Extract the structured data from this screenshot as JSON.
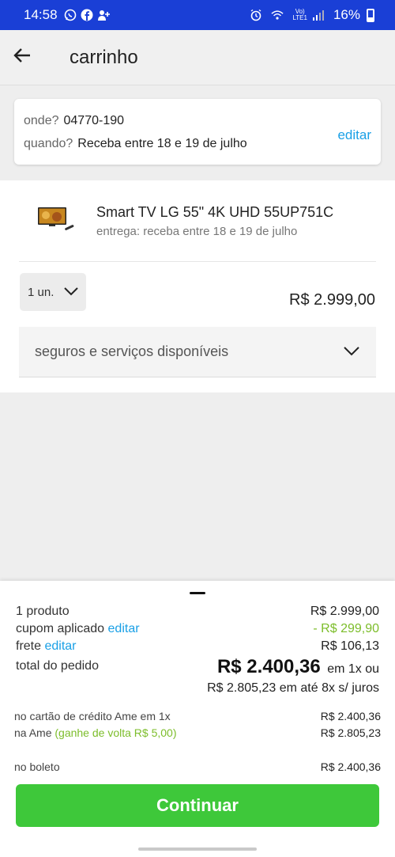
{
  "status_bar": {
    "time": "14:58",
    "network": "Vo)\nLTE1",
    "battery_percent": "16%",
    "left_icons": [
      "whatsapp-icon",
      "facebook-icon",
      "contact-add-icon"
    ],
    "right_icons": [
      "alarm-icon",
      "wifi-icon",
      "signal-icon",
      "battery-icon"
    ]
  },
  "header": {
    "title": "carrinho",
    "back_icon": "arrow-left-icon"
  },
  "delivery": {
    "where_label": "onde?",
    "where_value": "04770-190",
    "when_label": "quando?",
    "when_value": "Receba entre 18 e 19 de julho",
    "edit_label": "editar"
  },
  "product": {
    "name": "Smart TV LG 55\" 4K UHD 55UP751C",
    "delivery_text": "entrega: receba entre 18 e 19 de julho",
    "quantity": "1 un.",
    "price": "R$ 2.999,00",
    "services_label": "seguros e serviços disponíveis"
  },
  "summary": {
    "products_label": "1 produto",
    "products_value": "R$ 2.999,00",
    "coupon_label": "cupom aplicado",
    "coupon_edit": "editar",
    "coupon_value": "- R$ 299,90",
    "shipping_label": "frete",
    "shipping_edit": "editar",
    "shipping_value": "R$ 106,13",
    "total_label": "total do pedido",
    "total_value": "R$ 2.400,36",
    "total_suffix": "em 1x ou",
    "total_installments": "R$ 2.805,23 em até 8x s/ juros",
    "ame_card_label": "no cartão de crédito Ame em 1x",
    "ame_card_value": "R$ 2.400,36",
    "ame_label": "na Ame",
    "ame_cashback": "(ganhe de volta R$ 5,00)",
    "ame_value": "R$ 2.805,23",
    "boleto_label": "no boleto",
    "boleto_value": "R$ 2.400,36",
    "continue_label": "Continuar"
  },
  "colors": {
    "status_bar": "#1a3fd6",
    "link": "#1aa0e6",
    "discount": "#7cbd2a",
    "continue_button": "#3ec83a"
  }
}
